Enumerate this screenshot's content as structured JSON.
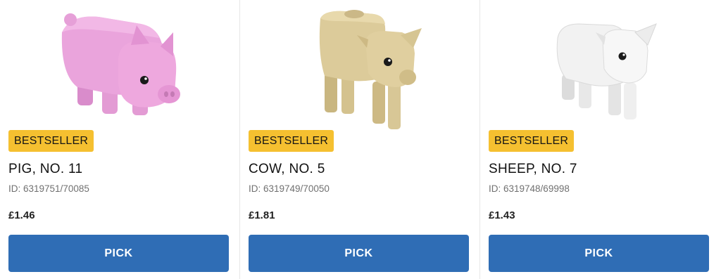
{
  "products": [
    {
      "image_icon": "pig-figure-icon",
      "badge": "BESTSELLER",
      "name": "PIG, NO. 11",
      "id_text": "ID: 6319751/70085",
      "price": "£1.46",
      "button_label": "PICK"
    },
    {
      "image_icon": "cow-figure-icon",
      "badge": "BESTSELLER",
      "name": "COW, NO. 5",
      "id_text": "ID: 6319749/70050",
      "price": "£1.81",
      "button_label": "PICK"
    },
    {
      "image_icon": "sheep-figure-icon",
      "badge": "BESTSELLER",
      "name": "SHEEP, NO. 7",
      "id_text": "ID: 6319748/69998",
      "price": "£1.43",
      "button_label": "PICK"
    }
  ],
  "colors": {
    "badge_bg": "#f5c030",
    "button_bg": "#2f6db5",
    "pig": "#e8a0d8",
    "cow": "#d8c896",
    "sheep": "#f4f4f4"
  }
}
